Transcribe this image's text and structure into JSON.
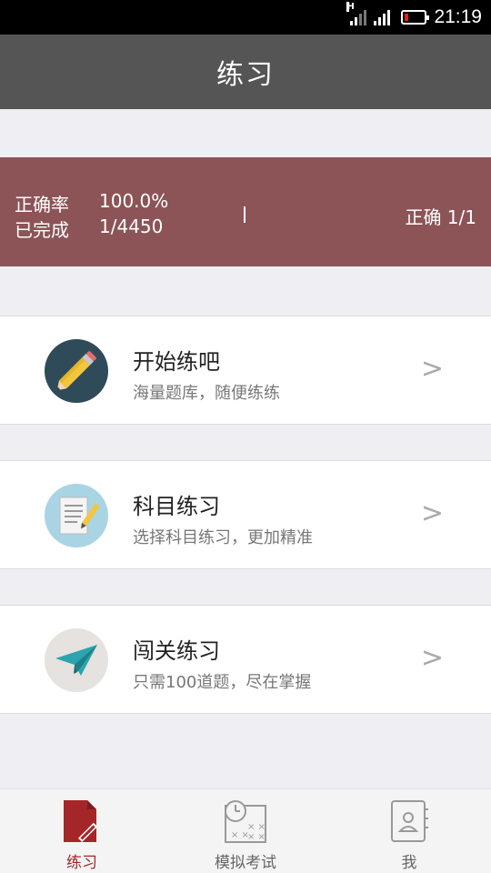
{
  "status_bar": {
    "time": "21:19",
    "network_letter": "H"
  },
  "header": {
    "title": "练习"
  },
  "stats": {
    "accuracy_label": "正确率",
    "accuracy_value": "100.0%",
    "completed_label": "已完成",
    "completed_value": "1/4450",
    "correct_text": "正确 1/1"
  },
  "menu": {
    "items": [
      {
        "title": "开始练吧",
        "subtitle": "海量题库，随便练练",
        "icon": "pencil-icon",
        "color": "#2f4b5a",
        "chevron": ">"
      },
      {
        "title": "科目练习",
        "subtitle": "选择科目练习，更加精准",
        "icon": "notepad-icon",
        "color": "#a9d4e4",
        "chevron": ">"
      },
      {
        "title": "闯关练习",
        "subtitle": "只需100道题，尽在掌握",
        "icon": "paper-plane-icon",
        "color": "#e6e2df",
        "chevron": ">"
      }
    ]
  },
  "bottom_nav": {
    "items": [
      {
        "label": "练习",
        "icon": "document-edit-icon",
        "active": true
      },
      {
        "label": "模拟考试",
        "icon": "clock-exam-icon",
        "active": false
      },
      {
        "label": "我",
        "icon": "profile-book-icon",
        "active": false
      }
    ]
  },
  "colors": {
    "title_bar": "#555555",
    "stats_band": "#8c5457",
    "accent": "#a52628"
  }
}
